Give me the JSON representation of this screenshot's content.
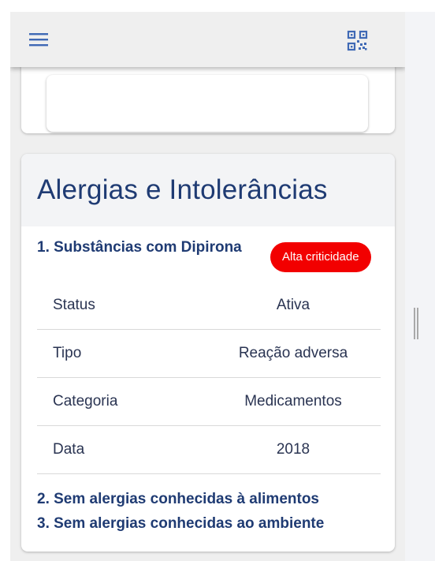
{
  "topbar": {
    "menu_icon": "hamburger-menu-icon",
    "qr_icon": "qr-code-icon"
  },
  "section": {
    "title": "Alergias e Intolerâncias"
  },
  "allergies": [
    {
      "title": "1. Substâncias com Dipirona",
      "badge": "Alta criticidade",
      "badge_color": "#f20000",
      "details": [
        {
          "label": "Status",
          "value": "Ativa"
        },
        {
          "label": "Tipo",
          "value": "Reação adversa"
        },
        {
          "label": "Categoria",
          "value": "Medicamentos"
        },
        {
          "label": "Data",
          "value": "2018"
        }
      ]
    },
    {
      "title": "2. Sem alergias conhecidas à alimentos"
    },
    {
      "title": "3. Sem alergias conhecidas ao ambiente"
    }
  ],
  "colors": {
    "title": "#1f3b73",
    "accent": "#3f69b5"
  }
}
